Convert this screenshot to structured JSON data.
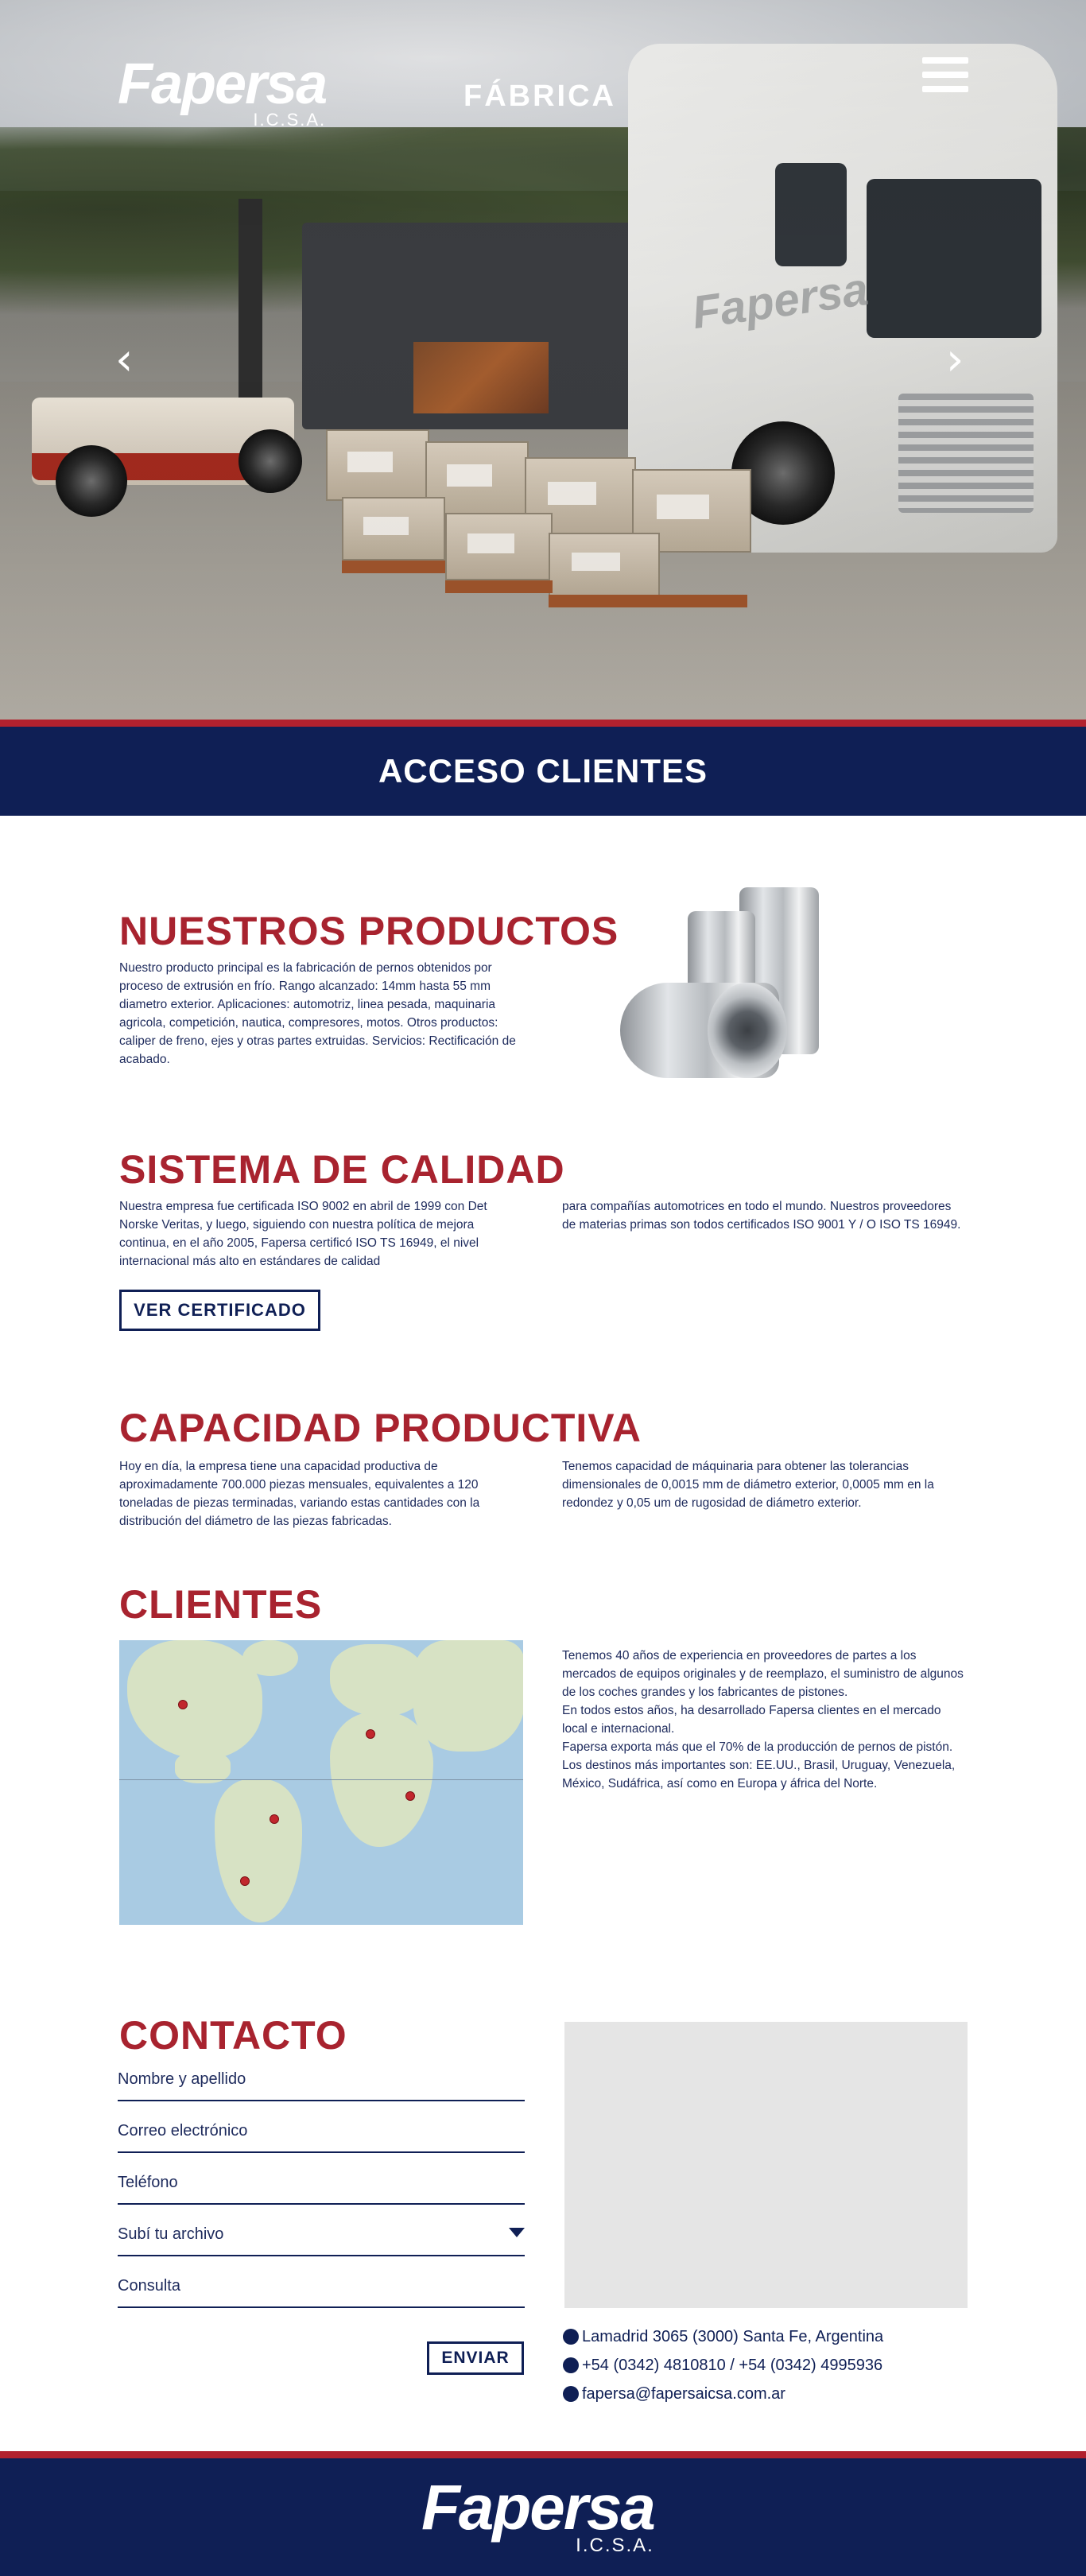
{
  "header": {
    "logo_text": "Fapersa",
    "logo_sub": "I.C.S.A.",
    "page_title": "FÁBRICA",
    "menu_icon": "hamburger-menu-icon",
    "prev_icon": "chevron-left-icon",
    "next_icon": "chevron-right-icon",
    "prev_symbol": "‹",
    "next_symbol": "›"
  },
  "access": {
    "label": "ACCESO CLIENTES"
  },
  "productos": {
    "title": "NUESTROS PRODUCTOS",
    "text": "Nuestro producto principal es la fabricación de pernos obtenidos por proceso de extrusión en frío. Rango alcanzado: 14mm hasta 55 mm diametro exterior. Aplicaciones: automotriz, linea pesada, maquinaria agricola, competición, nautica, compresores, motos. Otros productos: caliper de freno, ejes y otras partes extruidas. Servicios: Rectificación de acabado."
  },
  "calidad": {
    "title": "SISTEMA DE CALIDAD",
    "col1": "Nuestra empresa fue certificada ISO 9002 en abril de 1999 con Det Norske Veritas, y luego, siguiendo con nuestra política de mejora continua, en el año 2005, Fapersa certificó ISO TS 16949, el nivel internacional más alto en estándares de calidad",
    "col2": "para compañías automotrices en todo el mundo. Nuestros proveedores de materias primas son todos certificados ISO 9001 Y / O ISO TS 16949.",
    "button": "VER CERTIFICADO"
  },
  "capacidad": {
    "title": "CAPACIDAD PRODUCTIVA",
    "col1": "Hoy en día, la empresa tiene una capacidad productiva de aproximadamente 700.000 piezas mensuales, equivalentes a 120 toneladas de piezas terminadas, variando estas cantidades con la distribución del diámetro de las piezas fabricadas.",
    "col2": "Tenemos capacidad de máquinaria para obtener las tolerancias dimensionales de 0,0015 mm de diámetro exterior, 0,0005 mm en la redondez y 0,05 um de rugosidad de diámetro exterior."
  },
  "clientes": {
    "title": "CLIENTES",
    "paragraphs": [
      "Tenemos 40 años de experiencia en proveedores de partes a los mercados de equipos originales y de reemplazo, el suministro de algunos de los coches grandes y los fabricantes de pistones.",
      "En todos estos años, ha desarrollado Fapersa clientes en el mercado local e internacional.",
      "Fapersa exporta más que el 70% de la producción de pernos de pistón.",
      "Los destinos más importantes son: EE.UU., Brasil, Uruguay, Venezuela, México, Sudáfrica, así como en Europa y áfrica del Norte."
    ]
  },
  "contacto": {
    "title": "CONTACTO",
    "fields": {
      "name": "Nombre y apellido",
      "email": "Correo electrónico",
      "phone": "Teléfono",
      "file": "Subí tu archivo",
      "query": "Consulta"
    },
    "send": "ENVIAR",
    "address": "Lamadrid 3065 (3000) Santa Fe, Argentina",
    "phones": "+54 (0342) 4810810 / +54 (0342) 4995936",
    "email": "fapersa@fapersaicsa.com.ar"
  },
  "footer": {
    "logo_text": "Fapersa",
    "logo_sub": "I.C.S.A."
  },
  "colors": {
    "navy": "#0f1f55",
    "red": "#a8232f",
    "accent_red": "#b2212e"
  }
}
